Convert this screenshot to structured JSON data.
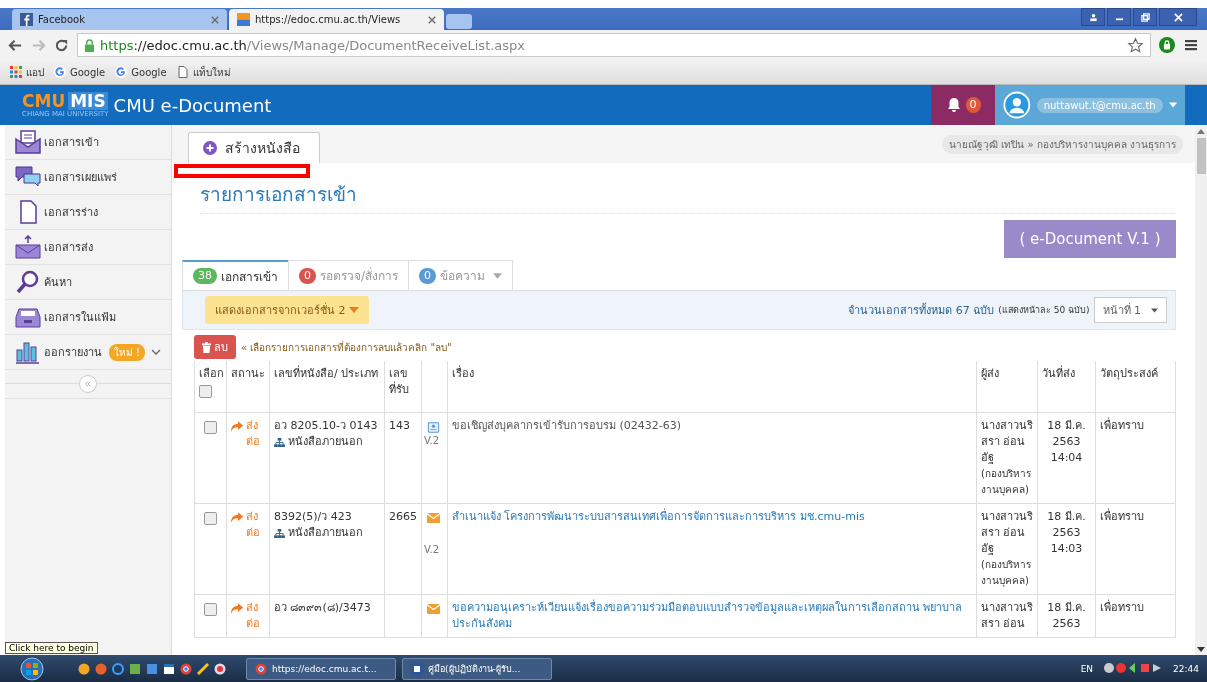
{
  "browser": {
    "tabs": [
      {
        "title": "Facebook",
        "selected": false
      },
      {
        "title": "https://edoc.cmu.ac.th/Views",
        "selected": true
      }
    ],
    "url": {
      "scheme": "https",
      "host": "://edoc.cmu.ac.th",
      "path": "/Views/Manage/DocumentReceiveList.aspx"
    },
    "bookmarks": [
      {
        "label": "แอป",
        "kind": "apps"
      },
      {
        "label": "Google",
        "kind": "google"
      },
      {
        "label": "Google",
        "kind": "google"
      },
      {
        "label": "แท็บใหม่",
        "kind": "page"
      }
    ]
  },
  "header": {
    "logo_left": "CMU",
    "logo_right": "MIS",
    "logo_tagline": "CHIANG MAI UNIVERSITY",
    "title": "CMU e-Document",
    "notifications": "0",
    "user_email": "nuttawut.t@cmu.ac.th"
  },
  "sidebar": {
    "items": [
      {
        "label": "เอกสารเข้า"
      },
      {
        "label": "เอกสารเผยแพร่"
      },
      {
        "label": "เอกสารร่าง"
      },
      {
        "label": "เอกสารส่ง"
      },
      {
        "label": "ค้นหา"
      },
      {
        "label": "เอกสารในแฟ้ม"
      },
      {
        "label": "ออกรายงาน",
        "badge": "ใหม่ !",
        "expandable": true
      }
    ]
  },
  "create_button": "สร้างหนังสือ",
  "breadcrumb": "นายณัฐวุฒิ เทปิน » กองบริหารงานบุคคล งานธุรการ",
  "page_title": "รายการเอกสารเข้า",
  "version_box": "( e-Document V.1 )",
  "tabs": [
    {
      "count": "38",
      "label": "เอกสารเข้า",
      "color": "#5cb85c",
      "selected": true,
      "dropdown": false
    },
    {
      "count": "0",
      "label": "รอตรวจ/สั่งการ",
      "color": "#d9534f",
      "selected": false,
      "dropdown": false
    },
    {
      "count": "0",
      "label": "ข้อความ",
      "color": "#5b9bd5",
      "selected": false,
      "dropdown": true
    }
  ],
  "version_filter": "แสดงเอกสารจากเวอร์ชั่น 2",
  "total": "จำนวนเอกสารทั้งหมด 67 ฉบับ",
  "per_page": "(แสดงหน้าละ 50 ฉบับ)",
  "page_select": "หน้าที่ 1",
  "delete_button": "ลบ",
  "delete_hint": "« เลือกรายการเอกสารที่ต้องการลบแล้วคลิก \"ลบ\"",
  "table": {
    "select_all_checked": false,
    "columns": [
      "เลือก",
      "สถานะ",
      "เลขที่หนังสือ/ ประเภท",
      "เลข ที่รับ",
      "เรื่อง",
      "ผู้ส่ง",
      "วันที่ส่ง",
      "วัตถุประสงค์"
    ],
    "rows": [
      {
        "checked": false,
        "status": "ส่ง ต่อ",
        "number": "อว 8205.10-ว 0143",
        "type": "หนังสือภายนอก",
        "received": "143",
        "kind": "card",
        "version": "V.2",
        "subject": "ขอเชิญส่งบุคลากรเข้ารับการอบรม (02432-63)",
        "is_link": false,
        "sender": "นางสาวนริ สรา อ่อน อัฐ",
        "sender_unit": "(กองบริหาร งานบุคคล)",
        "date": "18 มี.ค. 2563 14:04",
        "purpose": "เพื่อทราบ"
      },
      {
        "checked": false,
        "status": "ส่ง ต่อ",
        "number": "8392(5)/ว 423",
        "type": "หนังสือภายนอก",
        "received": "2665",
        "kind": "envelope",
        "version": "V.2",
        "subject": "สำเนาแจ้ง โครงการพัฒนาระบบสารสนเทศเพื่อการจัดการและการบริหาร มช.cmu-mis",
        "is_link": true,
        "sender": "นางสาวนริ สรา อ่อน อัฐ",
        "sender_unit": "(กองบริหาร งานบุคคล)",
        "date": "18 มี.ค. 2563 14:03",
        "purpose": "เพื่อทราบ"
      },
      {
        "checked": false,
        "status": "ส่ง ต่อ",
        "number": "อว ๘๓๙๓(๘)/3473",
        "kind": "envelope",
        "subject": "ขอความอนุเคราะห์เวียนแจ้งเรื่องขอความร่วมมือตอบแบบสำรวจข้อมูลและเหตุผลในการเลือกสถาน พยาบาลประกันสังคม",
        "is_link": true,
        "sender": "นางสาวนริ สรา อ่อน",
        "date": "18 มี.ค. 2563",
        "purpose": "เพื่อทราบ"
      }
    ]
  },
  "tooltip": "Click here to begin",
  "taskbar": {
    "windows": [
      "https://edoc.cmu.ac.t...",
      "คู่มือ(ผู้ปฏิบัติงาน-ผู้รับ..."
    ],
    "language": "EN",
    "time": "22:44"
  }
}
